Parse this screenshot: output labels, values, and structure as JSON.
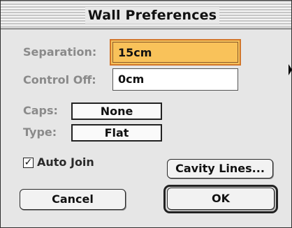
{
  "window": {
    "title": "Wall Preferences"
  },
  "fields": {
    "separation_label": "Separation:",
    "separation_value": "15cm",
    "control_label": "Control Off:",
    "control_value": "0cm"
  },
  "popups": {
    "caps_label": "Caps:",
    "caps_value": "None",
    "type_label": "Type:",
    "type_value": "Flat"
  },
  "options": {
    "auto_join_label": "Auto Join",
    "auto_join_checked": true,
    "check_glyph": "✓"
  },
  "buttons": {
    "cavity_lines": "Cavity Lines...",
    "cancel": "Cancel",
    "ok": "OK"
  },
  "colors": {
    "focus_highlight": "#f5c25c",
    "focus_border": "#d2762a",
    "disabled_label": "#8a8a8a"
  }
}
